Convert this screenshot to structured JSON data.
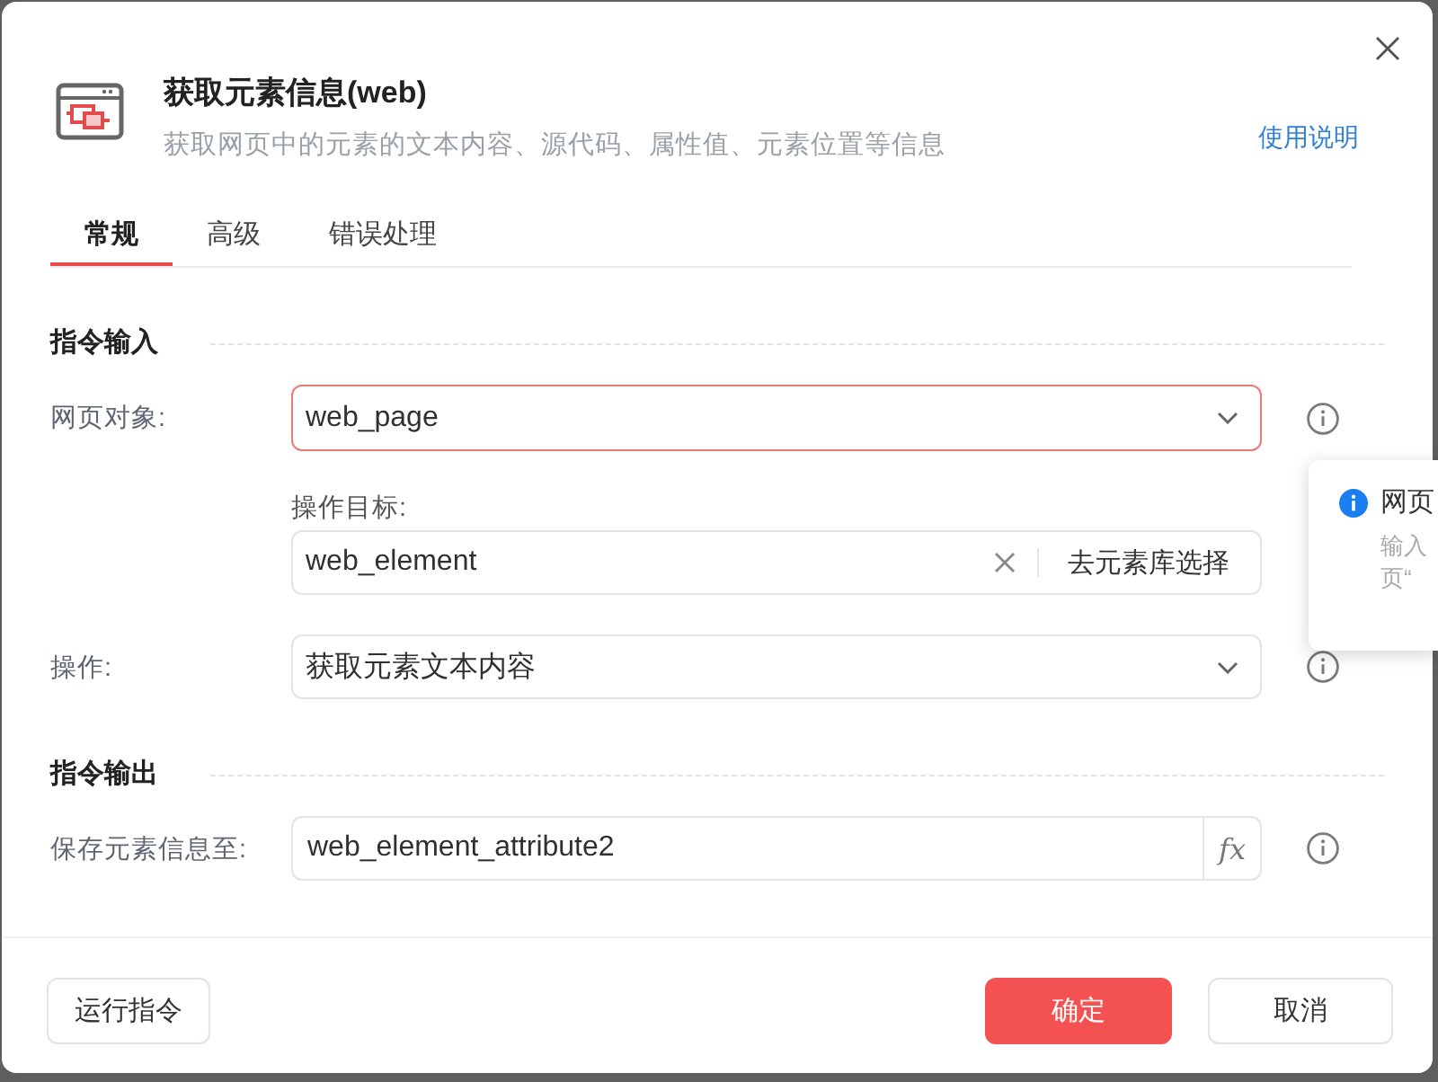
{
  "header": {
    "title": "获取元素信息(web)",
    "subtitle": "获取网页中的元素的文本内容、源代码、属性值、元素位置等信息",
    "help_link": "使用说明"
  },
  "tabs": [
    {
      "label": "常规",
      "selected": true
    },
    {
      "label": "高级",
      "selected": false
    },
    {
      "label": "错误处理",
      "selected": false
    }
  ],
  "sections": [
    {
      "title": "指令输入",
      "rows": [
        {
          "kind": "select",
          "label": "网页对象:",
          "value": "web_page",
          "focused": true,
          "info": true
        },
        {
          "kind": "element_picker",
          "sublabel": "操作目标:",
          "value": "web_element",
          "button": "去元素库选择",
          "clearable": true,
          "focused": false,
          "info": false
        },
        {
          "kind": "select",
          "label": "操作:",
          "value": "获取元素文本内容",
          "focused": false,
          "info": true
        }
      ]
    },
    {
      "title": "指令输出",
      "rows": [
        {
          "kind": "variable",
          "label": "保存元素信息至:",
          "value": "web_element_attribute2",
          "button": "fx",
          "focused": false,
          "info": true
        }
      ]
    }
  ],
  "popover": {
    "title": "网页",
    "lines": [
      "输入",
      "页“"
    ]
  },
  "footer": {
    "buttons": [
      {
        "label": "运行指令",
        "kind": "default"
      },
      {
        "label": "确定",
        "kind": "primary"
      },
      {
        "label": "取消",
        "kind": "default"
      }
    ]
  }
}
